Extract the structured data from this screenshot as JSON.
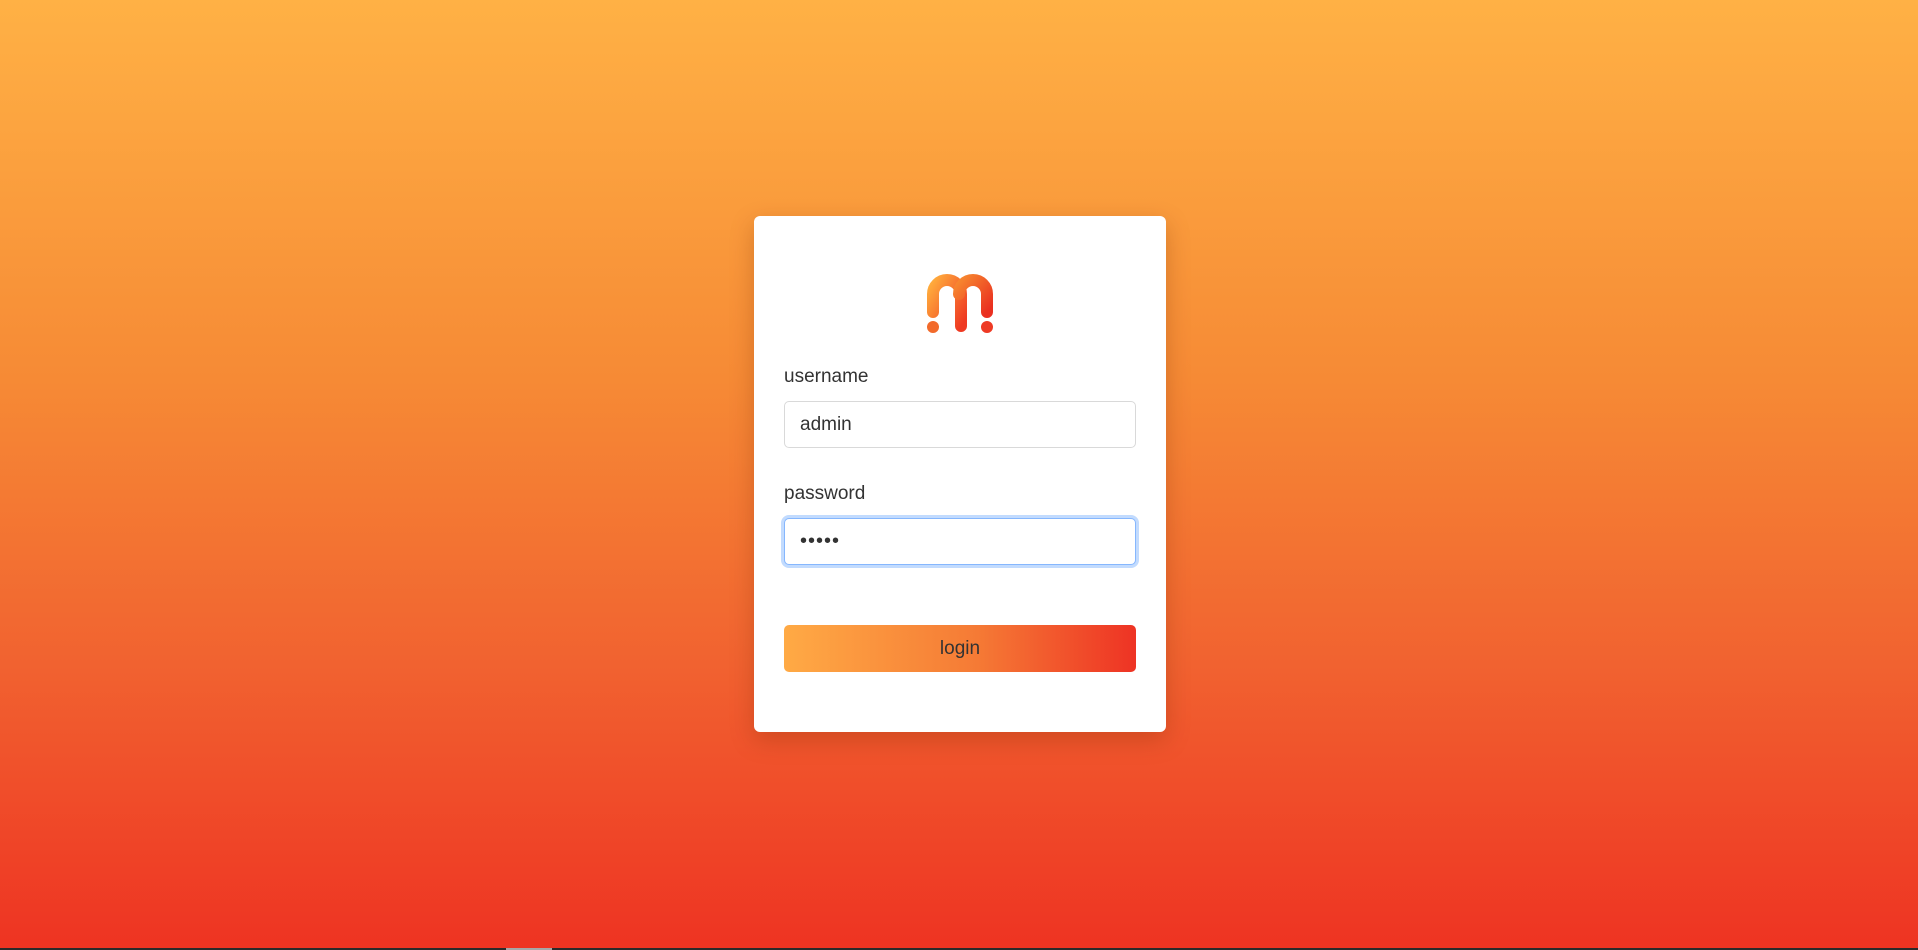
{
  "brand": {
    "logo_icon": "m-logo-icon",
    "colors": {
      "gradient_top": "#ffb145",
      "gradient_bottom": "#ee3322",
      "accent_orange": "#f79533",
      "accent_red": "#ee3324",
      "focus_ring": "#86b7fe"
    }
  },
  "form": {
    "username_label": "username",
    "username_value": "admin",
    "password_label": "password",
    "password_value": "•••••",
    "login_label": "login"
  }
}
